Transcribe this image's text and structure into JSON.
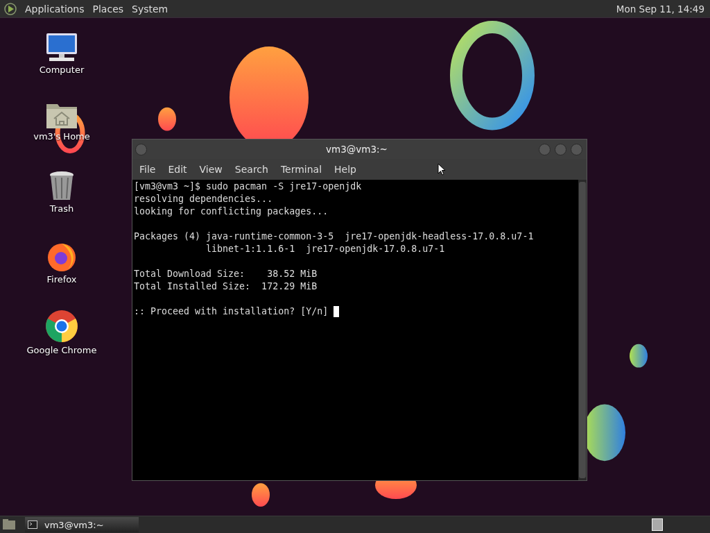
{
  "top_panel": {
    "menus": [
      "Applications",
      "Places",
      "System"
    ],
    "clock": "Mon Sep 11, 14:49"
  },
  "desktop_icons": [
    {
      "label": "Computer",
      "kind": "computer"
    },
    {
      "label": "vm3's Home",
      "kind": "home"
    },
    {
      "label": "Trash",
      "kind": "trash"
    },
    {
      "label": "Firefox",
      "kind": "firefox"
    },
    {
      "label": "Google Chrome",
      "kind": "chrome"
    }
  ],
  "window": {
    "title": "vm3@vm3:~",
    "menu": [
      "File",
      "Edit",
      "View",
      "Search",
      "Terminal",
      "Help"
    ],
    "blocks": [
      [
        "[vm3@vm3 ~]$ sudo pacman -S jre17-openjdk",
        "resolving dependencies...",
        "looking for conflicting packages..."
      ],
      [
        "Packages (4) java-runtime-common-3-5  jre17-openjdk-headless-17.0.8.u7-1",
        "             libnet-1:1.1.6-1  jre17-openjdk-17.0.8.u7-1"
      ],
      [
        "Total Download Size:    38.52 MiB",
        "Total Installed Size:  172.29 MiB"
      ],
      [
        ":: Proceed with installation? [Y/n] "
      ]
    ]
  },
  "taskbar": {
    "tasks": [
      {
        "label": "vm3@vm3:~",
        "selected": true
      }
    ]
  }
}
